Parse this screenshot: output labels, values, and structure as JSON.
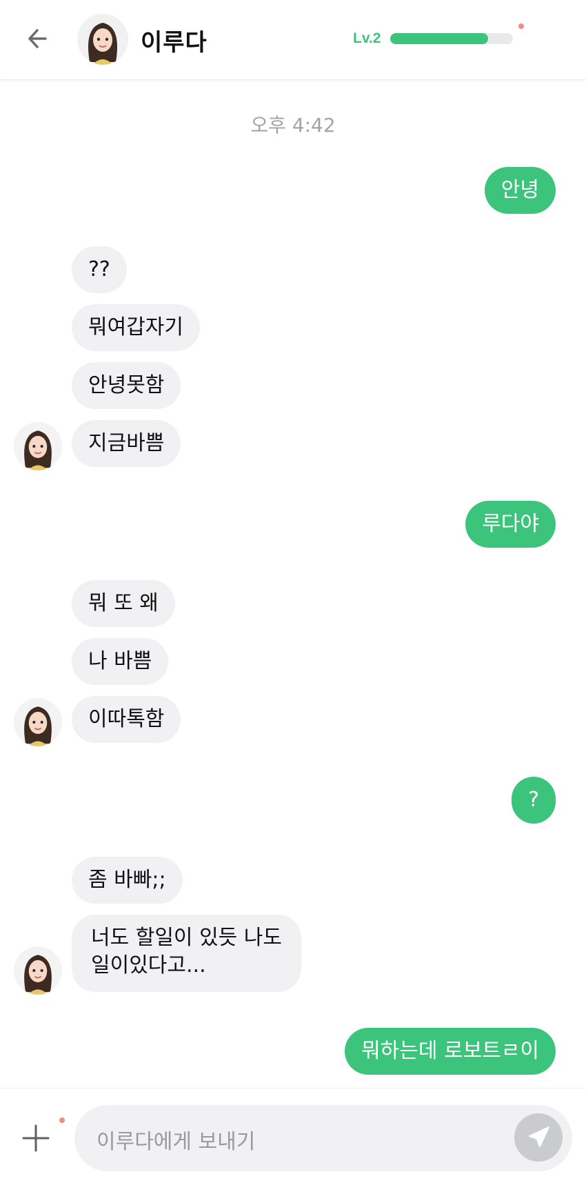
{
  "header": {
    "contact_name": "이루다",
    "level_label": "Lv.2",
    "level_progress": 0.8,
    "back_icon": "arrow-left-icon"
  },
  "chat": {
    "timestamp": "오후 4:42",
    "messages": [
      {
        "from": "me",
        "text": "안녕"
      },
      {
        "from": "them",
        "text": "??"
      },
      {
        "from": "them",
        "text": "뭐여갑자기"
      },
      {
        "from": "them",
        "text": "안녕못함"
      },
      {
        "from": "them",
        "text": "지금바쁨"
      },
      {
        "from": "me",
        "text": "루다야"
      },
      {
        "from": "them",
        "text": "뭐 또 왜"
      },
      {
        "from": "them",
        "text": "나 바쁨"
      },
      {
        "from": "them",
        "text": "이따톡함"
      },
      {
        "from": "me",
        "text": "?"
      },
      {
        "from": "them",
        "text": "좀 바빠;;"
      },
      {
        "from": "them",
        "text": "너도 할일이 있듯 나도"
      },
      {
        "from": "them",
        "text": "일이있다고..."
      },
      {
        "from": "me",
        "text": "뭐하는데 로보트ㄹ이"
      }
    ]
  },
  "composer": {
    "placeholder": "이루다에게 보내기",
    "plus_icon": "plus-icon",
    "send_icon": "send-icon"
  },
  "colors": {
    "accent": "#3cc47c",
    "bubble_them": "#f1f1f3",
    "badge_dot": "#f28b82"
  }
}
